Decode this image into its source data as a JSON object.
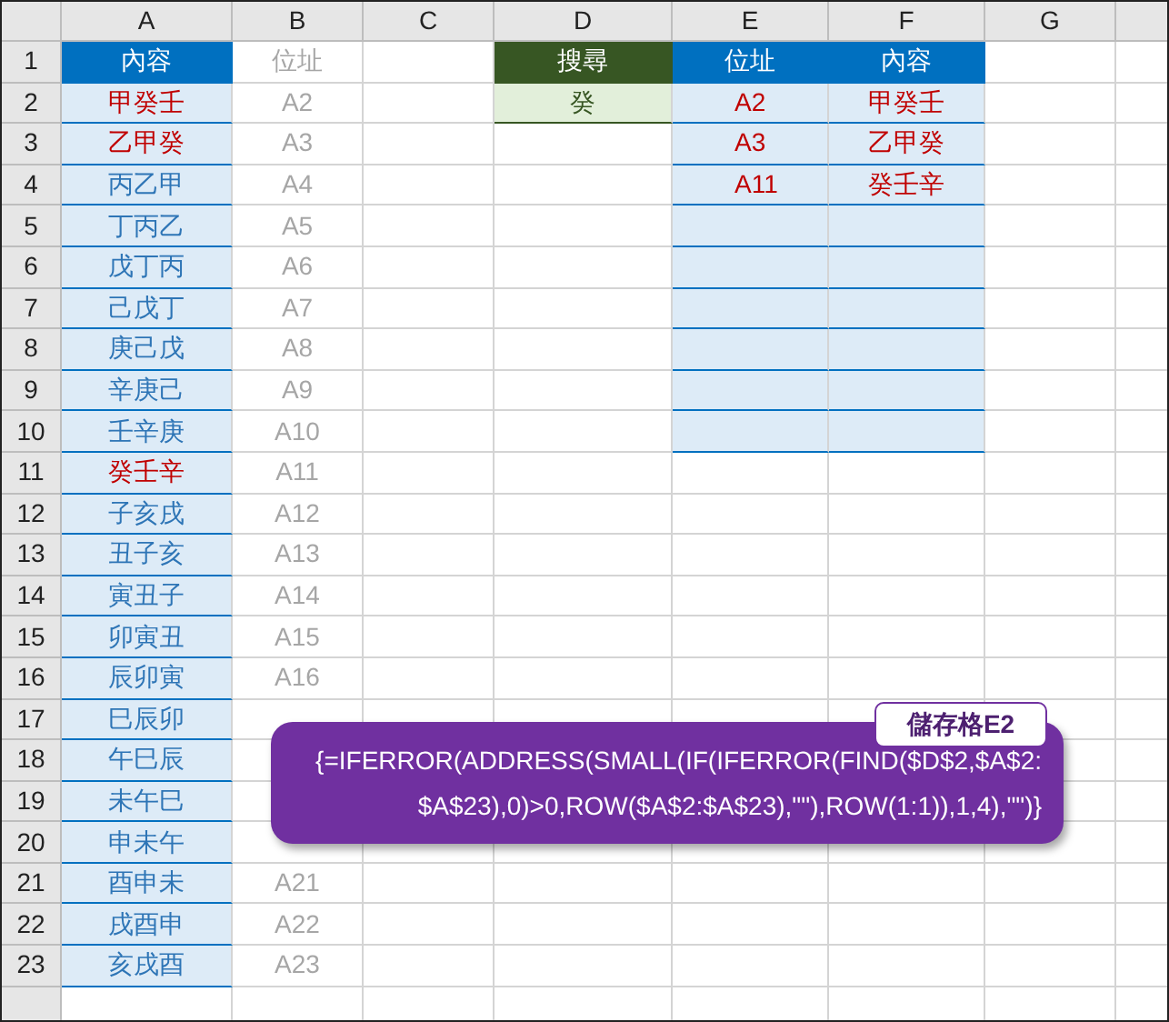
{
  "column_headers": [
    "A",
    "B",
    "C",
    "D",
    "E",
    "F",
    "G"
  ],
  "row_numbers": [
    "1",
    "2",
    "3",
    "4",
    "5",
    "6",
    "7",
    "8",
    "9",
    "10",
    "11",
    "12",
    "13",
    "14",
    "15",
    "16",
    "17",
    "18",
    "19",
    "20",
    "21",
    "22",
    "23"
  ],
  "source_table": {
    "content_header": "內容",
    "address_header": "位址",
    "rows": [
      {
        "content": "甲癸壬",
        "address": "A2",
        "matched": true
      },
      {
        "content": "乙甲癸",
        "address": "A3",
        "matched": true
      },
      {
        "content": "丙乙甲",
        "address": "A4",
        "matched": false
      },
      {
        "content": "丁丙乙",
        "address": "A5",
        "matched": false
      },
      {
        "content": "戊丁丙",
        "address": "A6",
        "matched": false
      },
      {
        "content": "己戊丁",
        "address": "A7",
        "matched": false
      },
      {
        "content": "庚己戊",
        "address": "A8",
        "matched": false
      },
      {
        "content": "辛庚己",
        "address": "A9",
        "matched": false
      },
      {
        "content": "壬辛庚",
        "address": "A10",
        "matched": false
      },
      {
        "content": "癸壬辛",
        "address": "A11",
        "matched": true
      },
      {
        "content": "子亥戌",
        "address": "A12",
        "matched": false
      },
      {
        "content": "丑子亥",
        "address": "A13",
        "matched": false
      },
      {
        "content": "寅丑子",
        "address": "A14",
        "matched": false
      },
      {
        "content": "卯寅丑",
        "address": "A15",
        "matched": false
      },
      {
        "content": "辰卯寅",
        "address": "A16",
        "matched": false
      },
      {
        "content": "巳辰卯",
        "matched": false
      },
      {
        "content": "午巳辰",
        "matched": false
      },
      {
        "content": "未午巳",
        "matched": false
      },
      {
        "content": "申未午",
        "matched": false
      },
      {
        "content": "酉申未",
        "address": "A21",
        "matched": false
      },
      {
        "content": "戌酉申",
        "address": "A22",
        "matched": false
      },
      {
        "content": "亥戌酉",
        "address": "A23",
        "matched": false
      }
    ]
  },
  "search": {
    "label": "搜尋",
    "value": "癸"
  },
  "results": {
    "address_header": "位址",
    "content_header": "內容",
    "rows": [
      {
        "address": "A2",
        "content": "甲癸壬"
      },
      {
        "address": "A3",
        "content": "乙甲癸"
      },
      {
        "address": "A11",
        "content": "癸壬辛"
      }
    ]
  },
  "callout": {
    "tag": "儲存格E2",
    "lines": [
      "{=IFERROR(ADDRESS(SMALL(IF(IFERROR(FIND($D$2,$A$2:",
      "$A$23),0)>0,ROW($A$2:$A$23),\"\"),ROW(1:1)),1,4),\"\")}"
    ]
  }
}
